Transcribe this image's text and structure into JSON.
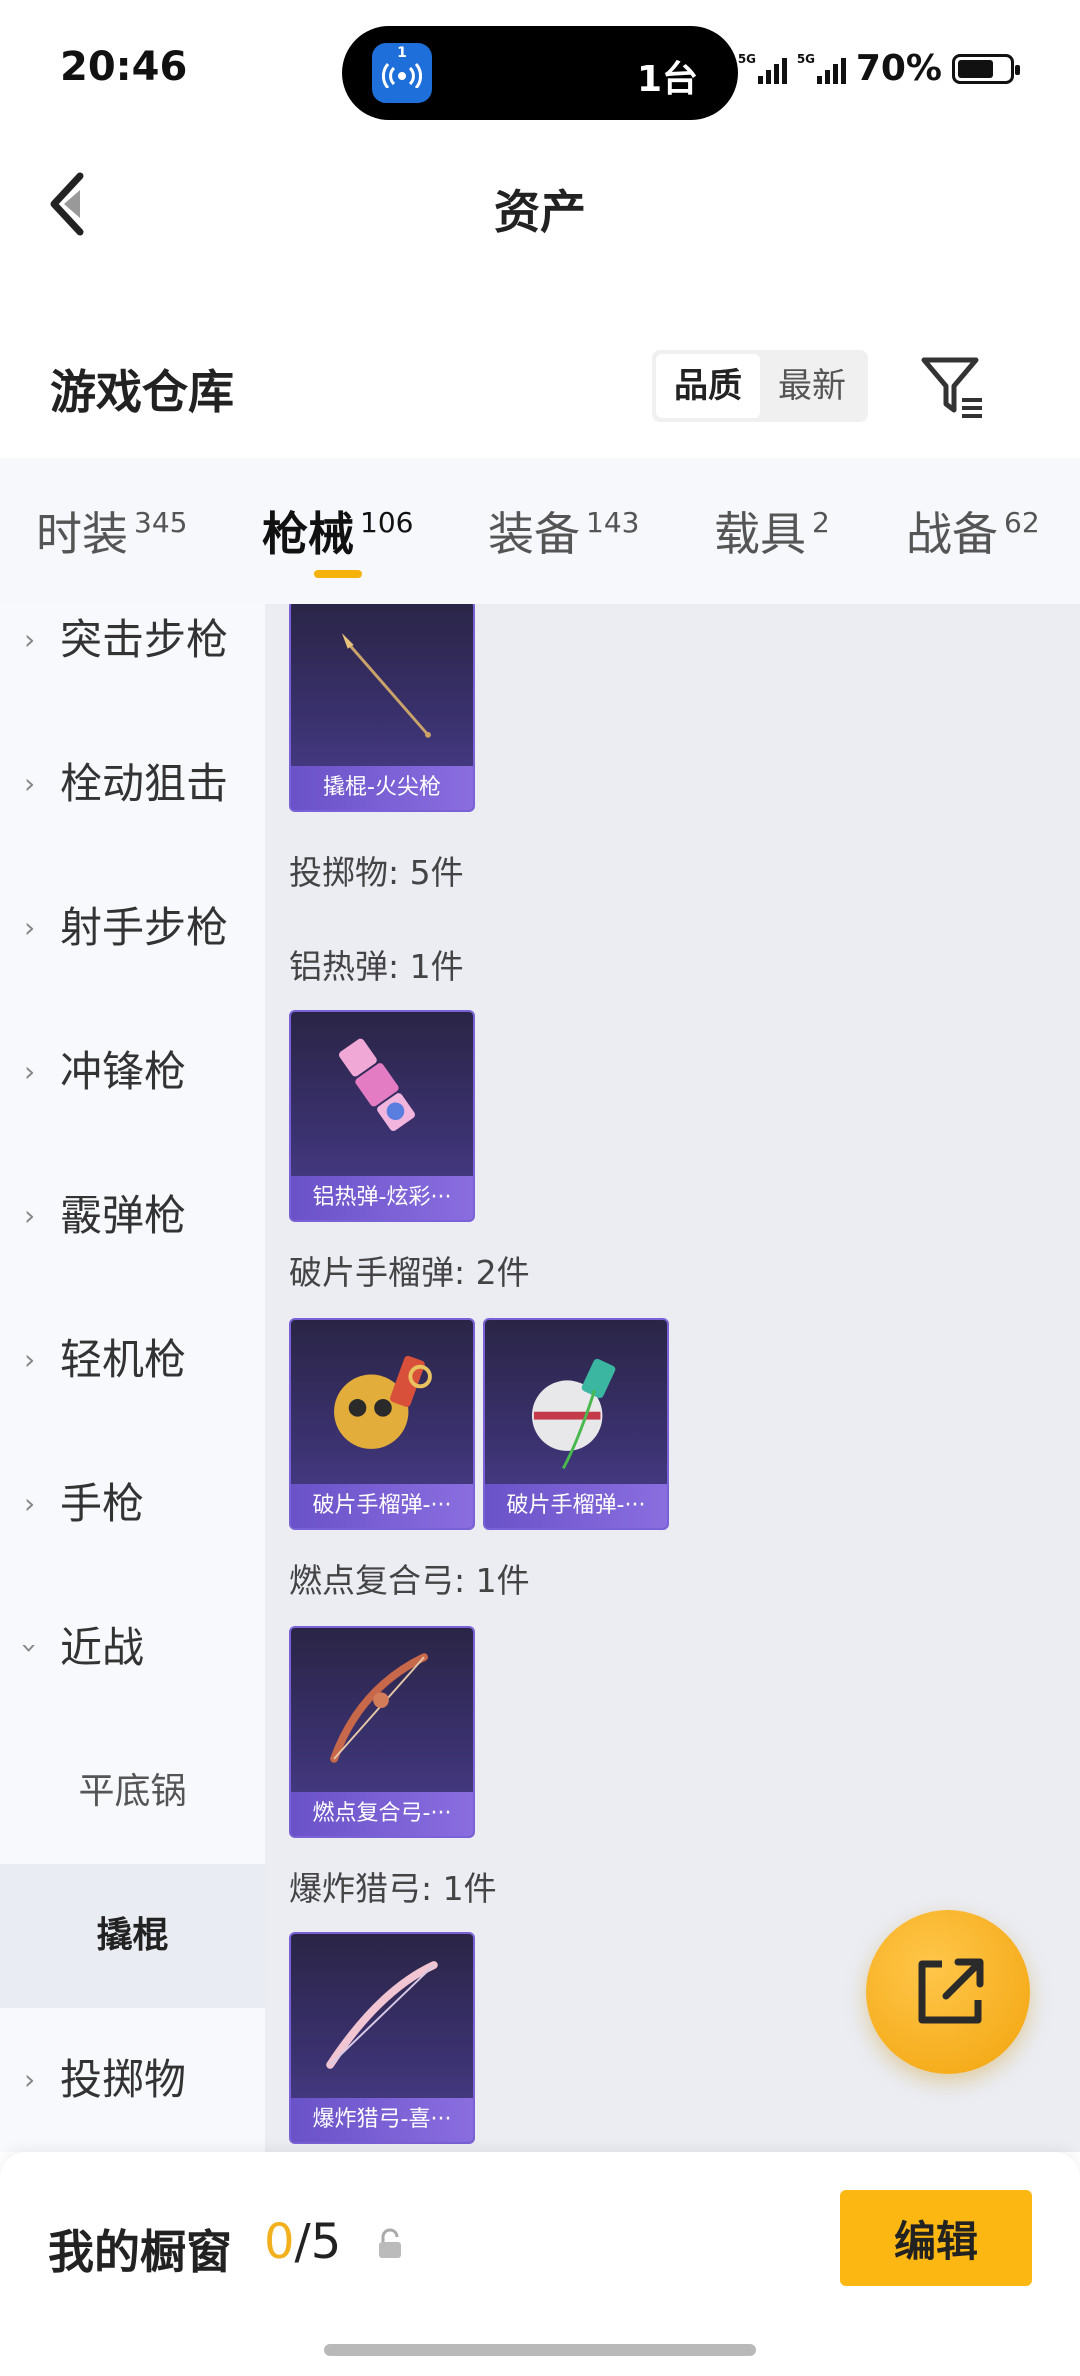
{
  "status_bar": {
    "time": "20:46",
    "island_badge": "1",
    "island_text": "1台",
    "network_1": "5G",
    "network_2": "5G",
    "battery_percent": "70%",
    "battery_level": 0.7
  },
  "header": {
    "title": "资产",
    "back_icon": "chevron-left-icon"
  },
  "section": {
    "title": "游戏仓库",
    "sort_options": [
      "品质",
      "最新"
    ],
    "sort_selected": "品质",
    "filter_icon": "filter-icon"
  },
  "tabs": [
    {
      "label": "时装",
      "count": "345",
      "active": false
    },
    {
      "label": "枪械",
      "count": "106",
      "active": true
    },
    {
      "label": "装备",
      "count": "143",
      "active": false
    },
    {
      "label": "载具",
      "count": "2",
      "active": false
    },
    {
      "label": "战备",
      "count": "62",
      "active": false
    }
  ],
  "sidebar": {
    "items": [
      {
        "label": "突击步枪",
        "expanded": false
      },
      {
        "label": "栓动狙击",
        "expanded": false
      },
      {
        "label": "射手步枪",
        "expanded": false
      },
      {
        "label": "冲锋枪",
        "expanded": false
      },
      {
        "label": "霰弹枪",
        "expanded": false
      },
      {
        "label": "轻机枪",
        "expanded": false
      },
      {
        "label": "手枪",
        "expanded": false
      },
      {
        "label": "近战",
        "expanded": true
      },
      {
        "label": "平底锅",
        "sub": true
      },
      {
        "label": "撬棍",
        "sub": true,
        "selected": true
      },
      {
        "label": "投掷物",
        "expanded": false
      }
    ]
  },
  "content": {
    "card_crowbar": "撬棍-火尖枪",
    "throwables_heading": "投掷物: 5件",
    "group_thermite": "铝热弹: 1件",
    "card_thermite": "铝热弹-炫彩···",
    "group_frag": "破片手榴弹: 2件",
    "card_frag_1": "破片手榴弹-···",
    "card_frag_2": "破片手榴弹-···",
    "group_compound_bow": "燃点复合弓: 1件",
    "card_compound_bow": "燃点复合弓-···",
    "group_explosive_bow": "爆炸猎弓: 1件",
    "card_explosive_bow": "爆炸猎弓-喜···",
    "share_icon": "share-icon"
  },
  "bottom_bar": {
    "showcase_label": "我的橱窗",
    "showcase_used": "0",
    "showcase_total": "/5",
    "lock_icon": "lock-icon",
    "edit_label": "编辑"
  }
}
